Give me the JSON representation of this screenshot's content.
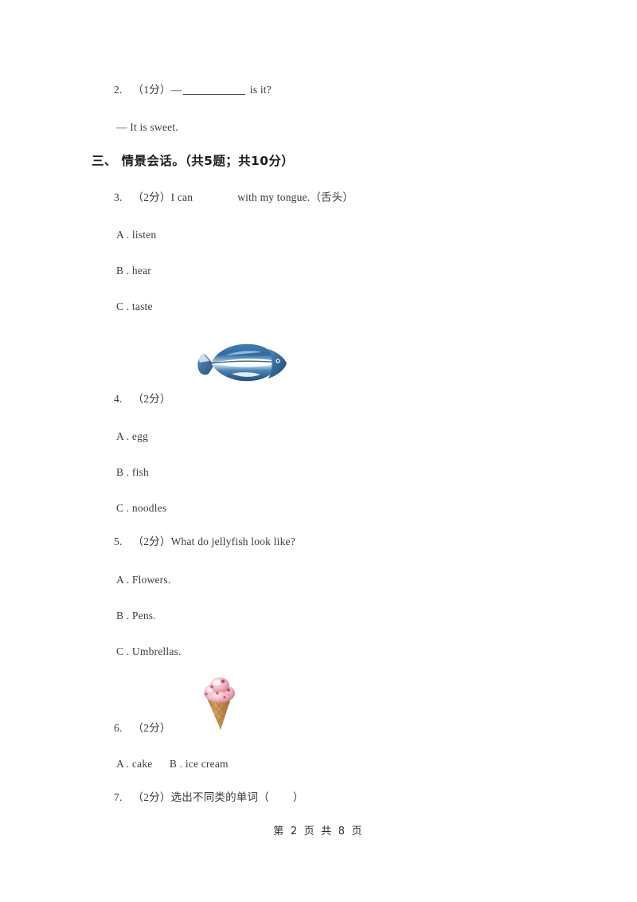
{
  "document": {
    "page_footer": "第 2 页 共 8 页",
    "text_color": "#3b3b3b",
    "heading_color": "#1d1d1d",
    "background": "#ffffff"
  },
  "questions": {
    "q2": {
      "number": "2.",
      "score": "（1分）",
      "prefix": "—",
      "suffix": " is it?",
      "reply": "— It is sweet."
    },
    "q3": {
      "number": "3.",
      "score": "（2分）",
      "stem_before": "I can",
      "stem_after": "with my tongue.（舌头）",
      "options": [
        "A . listen",
        "B . hear",
        "C . taste"
      ]
    },
    "q4": {
      "number": "4.",
      "score": "（2分）",
      "options": [
        "A . egg",
        "B . fish",
        "C . noodles"
      ]
    },
    "q5": {
      "number": "5.",
      "score": "（2分）",
      "stem": "What do jellyfish look like?",
      "options": [
        "A . Flowers.",
        "B . Pens.",
        "C . Umbrellas."
      ]
    },
    "q6": {
      "number": "6.",
      "score": "（2分）",
      "options_inline": "A . cake      B . ice cream"
    },
    "q7": {
      "number": "7.",
      "score": "（2分）",
      "stem_before": "选出不同类的单词（",
      "stem_after": "）"
    }
  },
  "sections": {
    "section_three": "三、 情景会话。（共5题；共10分）"
  },
  "figures": {
    "fish": {
      "name": "fish-illustration",
      "alt": "blue flatfish",
      "colors": [
        "#2f6ea5",
        "#1b4e7d",
        "#8fc2e3",
        "#ffffff"
      ]
    },
    "ice_cream": {
      "name": "ice-cream-cone-illustration",
      "alt": "strawberry ice cream cone",
      "colors": [
        "#e8a0ae",
        "#f7d9e0",
        "#c4636f",
        "#c08a4e",
        "#a9713a"
      ]
    }
  }
}
